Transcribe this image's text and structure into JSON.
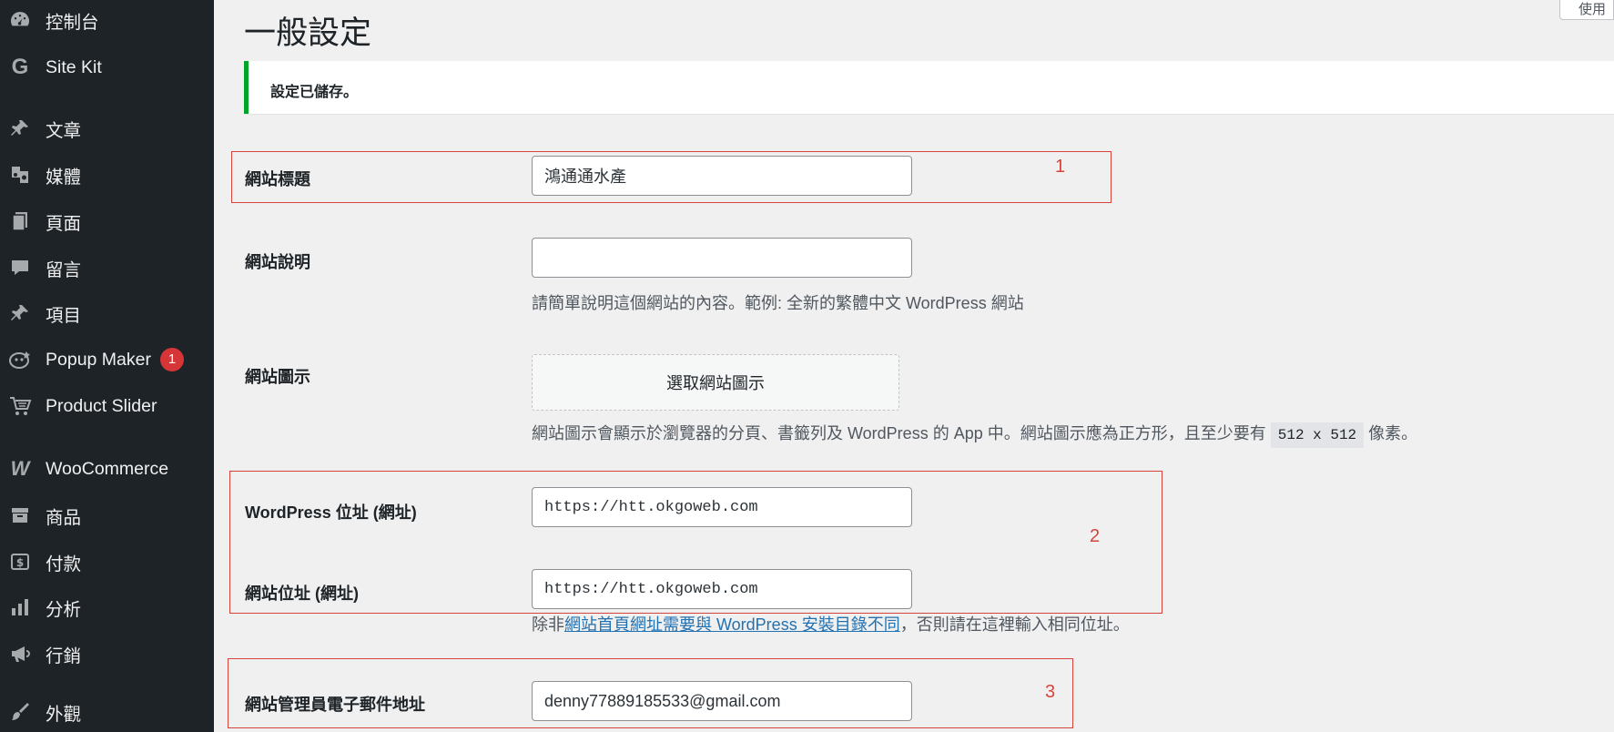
{
  "sidebar": {
    "items": [
      {
        "label": "控制台",
        "icon": "dashboard-icon"
      },
      {
        "label": "Site Kit",
        "icon": "google-g-icon"
      },
      {
        "label": "文章",
        "icon": "pin-icon"
      },
      {
        "label": "媒體",
        "icon": "media-icon"
      },
      {
        "label": "頁面",
        "icon": "pages-icon"
      },
      {
        "label": "留言",
        "icon": "comment-icon"
      },
      {
        "label": "項目",
        "icon": "pin-icon"
      },
      {
        "label": "Popup Maker",
        "icon": "popup-icon",
        "badge": "1"
      },
      {
        "label": "Product Slider",
        "icon": "cart-icon"
      },
      {
        "label": "WooCommerce",
        "icon": "woo-icon"
      },
      {
        "label": "商品",
        "icon": "archive-icon"
      },
      {
        "label": "付款",
        "icon": "payment-icon"
      },
      {
        "label": "分析",
        "icon": "bar-chart-icon"
      },
      {
        "label": "行銷",
        "icon": "megaphone-icon"
      },
      {
        "label": "外觀",
        "icon": "brush-icon"
      }
    ]
  },
  "header": {
    "title": "一般設定",
    "help_tab": "使用"
  },
  "notice": {
    "text": "設定已儲存。",
    "color": "#00a32a"
  },
  "form": {
    "site_title": {
      "label": "網站標題",
      "value": "鴻通通水產"
    },
    "tagline": {
      "label": "網站說明",
      "value": "",
      "description": "請簡單說明這個網站的內容。範例: 全新的繁體中文 WordPress 網站"
    },
    "site_icon": {
      "label": "網站圖示",
      "button": "選取網站圖示",
      "desc_before": "網站圖示會顯示於瀏覽器的分頁、書籤列及 WordPress 的 App 中。網站圖示應為正方形，且至少要有",
      "size_code": "512 x 512",
      "desc_after": "像素。"
    },
    "wp_address": {
      "label": "WordPress 位址 (網址)",
      "value": "https://htt.okgoweb.com"
    },
    "site_address": {
      "label": "網站位址 (網址)",
      "value": "https://htt.okgoweb.com",
      "desc_before": "除非",
      "desc_link": "網站首頁網址需要與 WordPress 安裝目錄不同",
      "desc_after": "，否則請在這裡輸入相同位址。"
    },
    "admin_email": {
      "label": "網站管理員電子郵件地址",
      "value": "denny77889185533@gmail.com"
    }
  },
  "annotations": {
    "color": "#d4443d",
    "labels": [
      "1",
      "2",
      "3"
    ]
  }
}
